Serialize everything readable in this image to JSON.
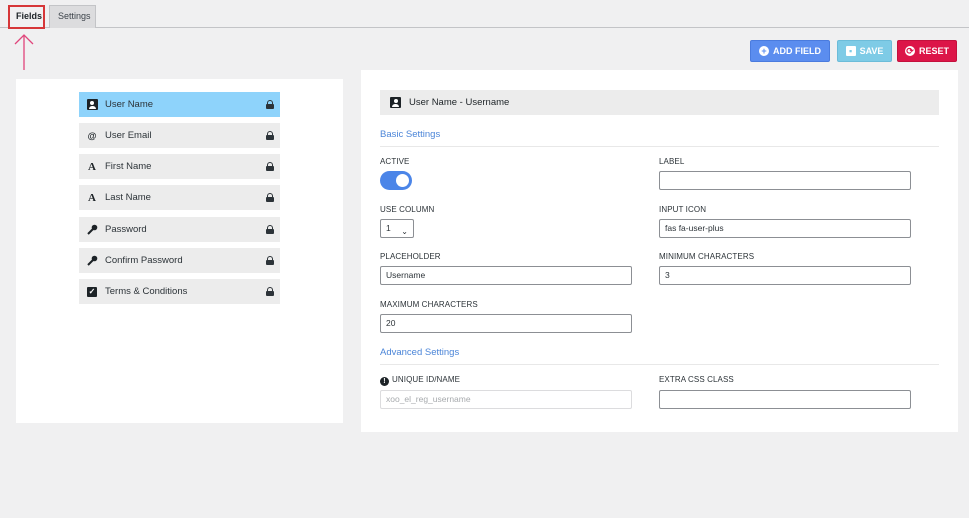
{
  "tabs": [
    {
      "label": "Fields",
      "active": true
    },
    {
      "label": "Settings",
      "active": false
    }
  ],
  "actions": {
    "add_field": "ADD FIELD",
    "save": "SAVE",
    "reset": "RESET"
  },
  "field_list": [
    {
      "label": "User Name",
      "icon": "user-icon",
      "active": true,
      "locked": true
    },
    {
      "label": "User Email",
      "icon": "at-icon",
      "active": false,
      "locked": true
    },
    {
      "label": "First Name",
      "icon": "font-icon",
      "active": false,
      "locked": true
    },
    {
      "label": "Last Name",
      "icon": "font-icon",
      "active": false,
      "locked": true
    },
    {
      "label": "Password",
      "icon": "key-icon",
      "active": false,
      "locked": true
    },
    {
      "label": "Confirm Password",
      "icon": "key-icon",
      "active": false,
      "locked": true
    },
    {
      "label": "Terms & Conditions",
      "icon": "checkbox-icon",
      "active": false,
      "locked": true
    }
  ],
  "editor": {
    "header": "User Name - Username",
    "basic_settings_title": "Basic Settings",
    "advanced_settings_title": "Advanced Settings",
    "active_label": "ACTIVE",
    "active_on": true,
    "label_label": "LABEL",
    "label_value": "",
    "use_column_label": "USE COLUMN",
    "use_column_value": "1",
    "input_icon_label": "INPUT ICON",
    "input_icon_value": "fas fa-user-plus",
    "placeholder_label": "PLACEHOLDER",
    "placeholder_value": "Username",
    "min_chars_label": "MINIMUM CHARACTERS",
    "min_chars_value": "3",
    "max_chars_label": "MAXIMUM CHARACTERS",
    "max_chars_value": "20",
    "unique_id_label": "UNIQUE ID/NAME",
    "unique_id_value": "xoo_el_reg_username",
    "extra_css_label": "EXTRA CSS CLASS",
    "extra_css_value": ""
  },
  "colors": {
    "primary": "#5b8def",
    "save": "#7ecbe6",
    "reset": "#dc1548",
    "active_item": "#8ed3fb",
    "highlight": "#d63638"
  }
}
